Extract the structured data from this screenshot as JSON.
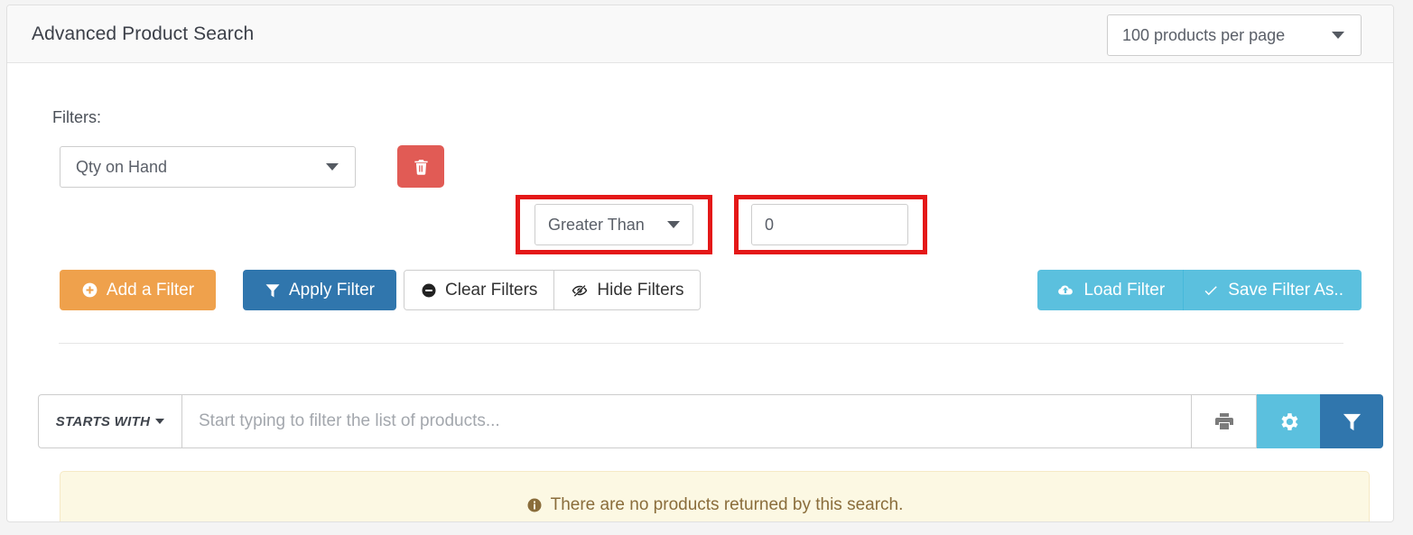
{
  "header": {
    "title": "Advanced Product Search",
    "per_page_value": "100 products per page",
    "per_page_icon": "chevron-down-icon"
  },
  "filters": {
    "label": "Filters:",
    "rows": [
      {
        "field_value": "Qty on Hand",
        "field_icon": "chevron-down-icon",
        "delete_icon": "trash-icon",
        "operator_value": "Greater Than",
        "operator_icon": "chevron-down-icon",
        "value": "0"
      }
    ],
    "actions": {
      "add_label": "Add a Filter",
      "add_icon": "plus-circle-icon",
      "apply_label": "Apply Filter",
      "apply_icon": "funnel-icon",
      "clear_label": "Clear Filters",
      "clear_icon": "minus-circle-icon",
      "hide_label": "Hide Filters",
      "hide_icon": "eye-slash-icon",
      "load_label": "Load Filter",
      "load_icon": "cloud-upload-icon",
      "save_label": "Save Filter As..",
      "save_icon": "check-icon"
    }
  },
  "search": {
    "mode_label": "STARTS WITH",
    "mode_icon": "caret-down-icon",
    "placeholder": "Start typing to filter the list of products...",
    "value": "",
    "print_icon": "printer-icon",
    "settings_icon": "gear-icon",
    "filter_icon": "funnel-icon"
  },
  "alert": {
    "icon": "info-circle-icon",
    "message": "There are no products returned by this search."
  },
  "colors": {
    "orange": "#efa14c",
    "blue": "#3076ad",
    "light_blue": "#5bc0de",
    "red": "#e15b55",
    "annotation_red": "#e41818",
    "alert_bg": "#fcf8e3",
    "alert_text": "#8a6d3b"
  }
}
